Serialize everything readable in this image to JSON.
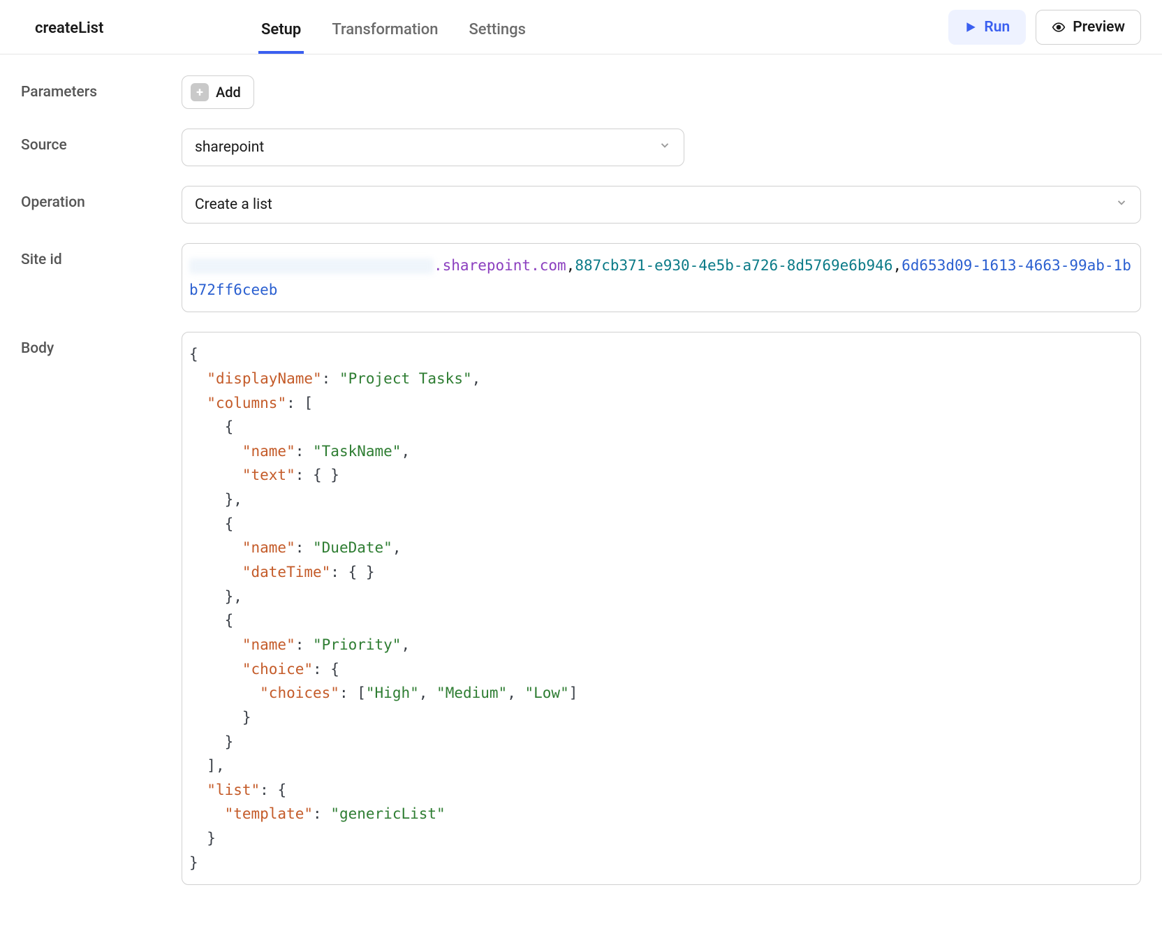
{
  "header": {
    "title": "createList",
    "tabs": {
      "setup": "Setup",
      "transformation": "Transformation",
      "settings": "Settings"
    },
    "run_label": "Run",
    "preview_label": "Preview"
  },
  "form": {
    "parameters_label": "Parameters",
    "add_label": "Add",
    "source_label": "Source",
    "source_value": "sharepoint",
    "operation_label": "Operation",
    "operation_value": "Create a list",
    "siteid_label": "Site id",
    "siteid": {
      "suffix": ".sharepoint.com",
      "sep1": ",",
      "guid1": "887cb371-e930-4e5b-a726-8d5769e6b946",
      "sep2": ",",
      "guid2": "6d653d09-1613-4663-99ab-1bb72ff6ceeb"
    },
    "body_label": "Body",
    "body_json": {
      "displayName": "Project Tasks",
      "columns": [
        {
          "name": "TaskName",
          "text": {}
        },
        {
          "name": "DueDate",
          "dateTime": {}
        },
        {
          "name": "Priority",
          "choice": {
            "choices": [
              "High",
              "Medium",
              "Low"
            ]
          }
        }
      ],
      "list": {
        "template": "genericList"
      }
    }
  }
}
